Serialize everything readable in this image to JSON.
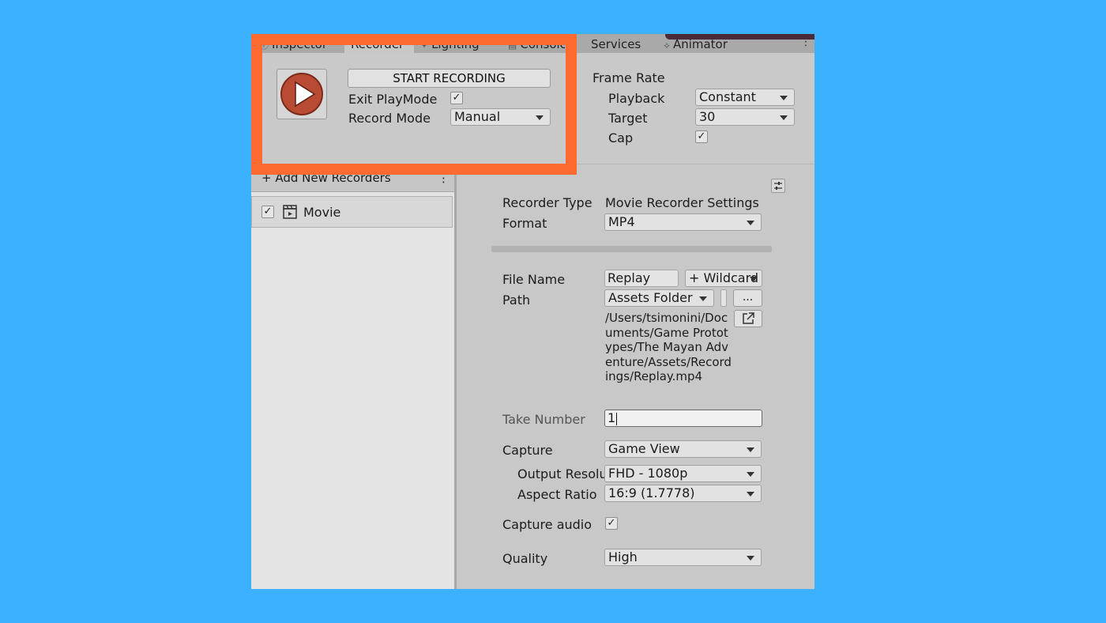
{
  "tabs": [
    {
      "label": "Inspector",
      "icon": "info-icon"
    },
    {
      "label": "Recorder",
      "icon": ""
    },
    {
      "label": "Lighting",
      "icon": "bulb-icon"
    },
    {
      "label": "Console",
      "icon": "console-icon"
    },
    {
      "label": "Services",
      "icon": ""
    },
    {
      "label": "Animator",
      "icon": "animator-icon"
    }
  ],
  "recorder": {
    "start_label": "START RECORDING",
    "exit_playmode_label": "Exit PlayMode",
    "exit_playmode_checked": "✓",
    "record_mode_label": "Record Mode",
    "record_mode_value": "Manual"
  },
  "frame_rate": {
    "title": "Frame Rate",
    "playback_label": "Playback",
    "playback_value": "Constant",
    "target_label": "Target",
    "target_value": "30",
    "cap_label": "Cap",
    "cap_checked": "✓"
  },
  "recorders_list": {
    "add_label": "+ Add New Recorders",
    "menu_glyph": "⋮",
    "items": [
      {
        "label": "Movie",
        "checked": "✓"
      }
    ]
  },
  "settings": {
    "recorder_type_label": "Recorder Type",
    "recorder_type_value": "Movie Recorder Settings",
    "format_label": "Format",
    "format_value": "MP4",
    "file_name_label": "File Name",
    "file_name_value": "Replay",
    "wildcards_label": "+ Wildcard",
    "path_label": "Path",
    "path_folder_value": "Assets Folder",
    "browse_label": "...",
    "path_full": "/Users/tsimonini/Documents/Game Prototypes/The Mayan Adventure/Assets/Recordings/Replay.mp4",
    "take_number_label": "Take Number",
    "take_number_value": "1",
    "capture_label": "Capture",
    "capture_value": "Game View",
    "output_resolution_label": "Output Resolut",
    "output_resolution_value": "FHD - 1080p",
    "aspect_ratio_label": "Aspect Ratio",
    "aspect_ratio_value": "16:9 (1.7778)",
    "capture_audio_label": "Capture audio",
    "capture_audio_checked": "✓",
    "quality_label": "Quality",
    "quality_value": "High"
  },
  "colors": {
    "background": "#3cb1ff",
    "highlight": "#ff6a31",
    "play_button": "#b94a33"
  }
}
